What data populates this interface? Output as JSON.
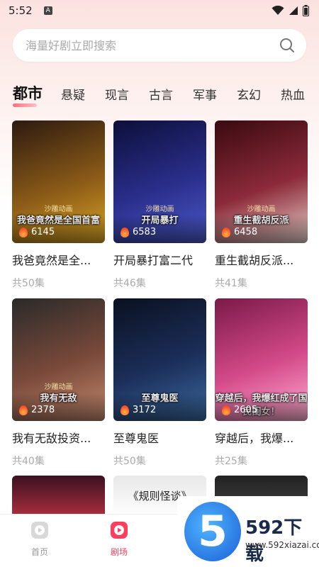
{
  "status": {
    "time": "5:52",
    "notif_letter": "A"
  },
  "search": {
    "placeholder": "海量好剧立即搜索"
  },
  "tabs": [
    {
      "label": "都市",
      "active": true
    },
    {
      "label": "悬疑"
    },
    {
      "label": "现言"
    },
    {
      "label": "古言"
    },
    {
      "label": "军事"
    },
    {
      "label": "玄幻"
    },
    {
      "label": "热血"
    }
  ],
  "dramas": [
    {
      "title": "我爸竟然是全...",
      "episodes": "共50集",
      "views": "6145",
      "cover_text": "我爸竟然是全国首富",
      "brand_text": "沙雕动画",
      "colors": [
        "#2c1a10",
        "#8a5a18",
        "#d9a524"
      ]
    },
    {
      "title": "开局暴打富二代",
      "episodes": "共46集",
      "views": "6583",
      "cover_text": "开局暴打",
      "brand_text": "沙雕动画",
      "colors": [
        "#0c0f3a",
        "#2b2f8c",
        "#4b5ac6"
      ]
    },
    {
      "title": "重生截胡反派...",
      "episodes": "共41集",
      "views": "6458",
      "cover_text": "重生截胡反派",
      "brand_text": "沙雕动画",
      "colors": [
        "#3a0a10",
        "#8c2a3a",
        "#e8d2c8"
      ]
    },
    {
      "title": "我有无敌投资...",
      "episodes": "共40集",
      "views": "2378",
      "cover_text": "我有无敌",
      "brand_text": "沙雕动画",
      "colors": [
        "#2a2a2a",
        "#7a4a3a",
        "#c48a70"
      ]
    },
    {
      "title": "至尊鬼医",
      "episodes": "共50集",
      "views": "3172",
      "cover_text": "至尊鬼医",
      "brand_text": "",
      "colors": [
        "#0a1020",
        "#1c2f5a",
        "#3c6aa0"
      ]
    },
    {
      "title": "穿越后，我爆...",
      "episodes": "共25集",
      "views": "2605",
      "cover_text": "穿越后，我爆红成了国民闺女！",
      "brand_text": "",
      "colors": [
        "#7a1a48",
        "#d44a8a",
        "#ffb0d0"
      ]
    }
  ],
  "peek_covers": [
    {
      "colors": [
        "#3a1020",
        "#b03040"
      ]
    },
    {
      "colors": [
        "#e8e8e8",
        "#ffffff"
      ],
      "text": "《规则怪谈》"
    },
    {
      "colors": [
        "#222222",
        "#444444"
      ]
    }
  ],
  "bottom_nav": [
    {
      "label": "首页",
      "active": false
    },
    {
      "label": "剧场",
      "active": true
    }
  ],
  "watermark": {
    "number": "5",
    "brand": "592下载",
    "url": "www.592xiazai.com"
  },
  "theme": {
    "accent": "#ff3e5f",
    "muted": "#aaaaaa"
  }
}
